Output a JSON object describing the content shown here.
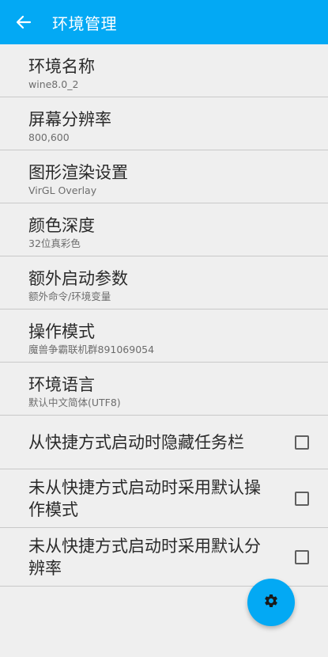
{
  "toolbar": {
    "title": "环境管理",
    "back_icon": "arrow-left-icon",
    "color": "#03a9f4"
  },
  "settings": [
    {
      "title": "环境名称",
      "subtitle": "wine8.0_2"
    },
    {
      "title": "屏幕分辨率",
      "subtitle": "800,600"
    },
    {
      "title": "图形渲染设置",
      "subtitle": "VirGL Overlay"
    },
    {
      "title": "颜色深度",
      "subtitle": "32位真彩色"
    },
    {
      "title": "额外启动参数",
      "subtitle": "额外命令/环境变量"
    },
    {
      "title": "操作模式",
      "subtitle": "魔兽争霸联机群891069054"
    },
    {
      "title": "环境语言",
      "subtitle": "默认中文简体(UTF8)"
    }
  ],
  "checkboxes": [
    {
      "label": "从快捷方式启动时隐藏任务栏",
      "checked": false
    },
    {
      "label": "未从快捷方式启动时采用默认操作模式",
      "checked": false
    },
    {
      "label": "未从快捷方式启动时采用默认分辨率",
      "checked": false
    }
  ],
  "fab": {
    "icon": "gear-icon"
  }
}
